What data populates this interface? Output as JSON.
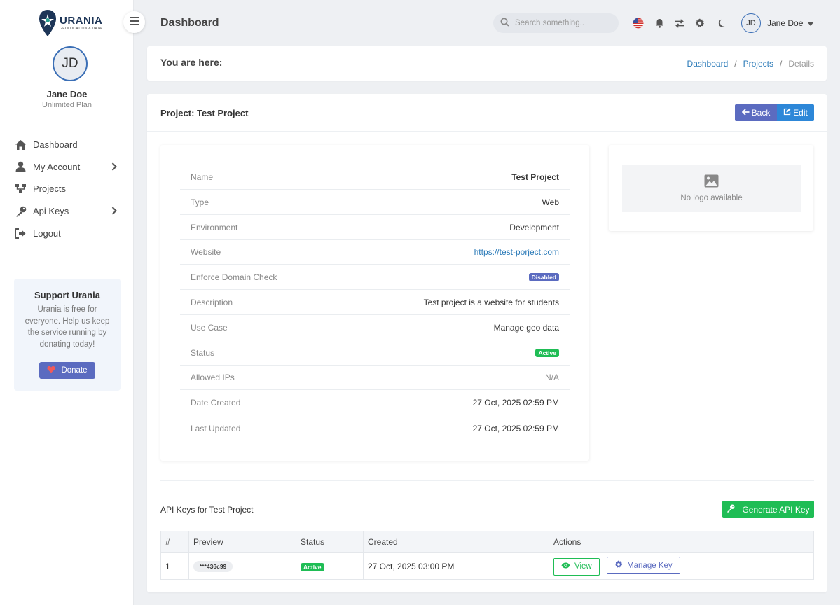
{
  "brand": {
    "name": "URANIA",
    "tagline": "GEOLOCATION & DATA"
  },
  "user": {
    "initials": "JD",
    "name": "Jane Doe",
    "plan": "Unlimited Plan",
    "header_name": "Jane Doe"
  },
  "sidebar": {
    "items": [
      {
        "label": "Dashboard",
        "icon": "home-icon"
      },
      {
        "label": "My Account",
        "icon": "user-icon"
      },
      {
        "label": "Projects",
        "icon": "projects-icon"
      },
      {
        "label": "Api Keys",
        "icon": "key-icon"
      },
      {
        "label": "Logout",
        "icon": "logout-icon"
      }
    ]
  },
  "support": {
    "title": "Support Urania",
    "text": "Urania is free for everyone. Help us keep the service running by donating today!",
    "donate_label": "Donate"
  },
  "header": {
    "title": "Dashboard",
    "search_placeholder": "Search something.."
  },
  "breadcrumb": {
    "label": "You are here:",
    "items": [
      "Dashboard",
      "Projects",
      "Details"
    ]
  },
  "project": {
    "title": "Project: Test Project",
    "back_label": "Back",
    "edit_label": "Edit",
    "details": [
      {
        "key": "Name",
        "value": "Test Project"
      },
      {
        "key": "Type",
        "value": "Web"
      },
      {
        "key": "Environment",
        "value": "Development"
      },
      {
        "key": "Website",
        "value": "https://test-porject.com"
      },
      {
        "key": "Enforce Domain Check",
        "value": "Disabled"
      },
      {
        "key": "Description",
        "value": "Test project is a website for students"
      },
      {
        "key": "Use Case",
        "value": "Manage geo data"
      },
      {
        "key": "Status",
        "value": "Active"
      },
      {
        "key": "Allowed IPs",
        "value": "N/A"
      },
      {
        "key": "Date Created",
        "value": "27 Oct, 2025 02:59 PM"
      },
      {
        "key": "Last Updated",
        "value": "27 Oct, 2025 02:59 PM"
      }
    ],
    "no_logo_text": "No logo available"
  },
  "api_keys": {
    "title": "API Keys for Test Project",
    "generate_label": "Generate API Key",
    "columns": [
      "#",
      "Preview",
      "Status",
      "Created",
      "Actions"
    ],
    "rows": [
      {
        "num": "1",
        "preview": "***436c99",
        "status": "Active",
        "created": "27 Oct, 2025 03:00 PM",
        "view_label": "View",
        "manage_label": "Manage Key"
      }
    ]
  },
  "colors": {
    "primary": "#5b6bc0",
    "blue": "#2d87d8",
    "green": "#1fbd55",
    "link": "#2a7ab8"
  }
}
